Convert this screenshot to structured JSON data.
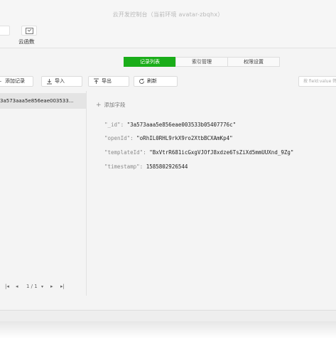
{
  "window": {
    "title": "云开发控制台（当前环境 avatar-zbqhx）"
  },
  "toolbar": {
    "cloud_functions_label": "云函数"
  },
  "tabs": [
    {
      "label": "记录列表",
      "active": true
    },
    {
      "label": "索引管理",
      "active": false
    },
    {
      "label": "权限设置",
      "active": false
    }
  ],
  "actions": {
    "add_record": "添加记录",
    "import": "导入",
    "export": "导出",
    "refresh": "刷新",
    "search_placeholder": "按 field:value 筛选"
  },
  "records": [
    {
      "id": "3a573aaa5e856eae003533..."
    }
  ],
  "pager": {
    "page": "1 / 1"
  },
  "detail": {
    "add_field": "添加字段",
    "fields": [
      {
        "key": "\"_id\"",
        "sep": ": ",
        "value": "\"3a573aaa5e856eae003533b05407776c\""
      },
      {
        "key": "\"openId\"",
        "sep": ": ",
        "value": "\"oRhIL0RHL9rkX9ro2XtbBCXAmKp4\""
      },
      {
        "key": "\"templateId\"",
        "sep": ": ",
        "value": "\"BxVtrR681icGxgVJOfJ8xdze6TsZiXd5mmUUXnd_9Zg\""
      },
      {
        "key": "\"timestamp\"",
        "sep": ": ",
        "value": "1585802926544"
      }
    ]
  },
  "colors": {
    "accent": "#1aad19"
  }
}
